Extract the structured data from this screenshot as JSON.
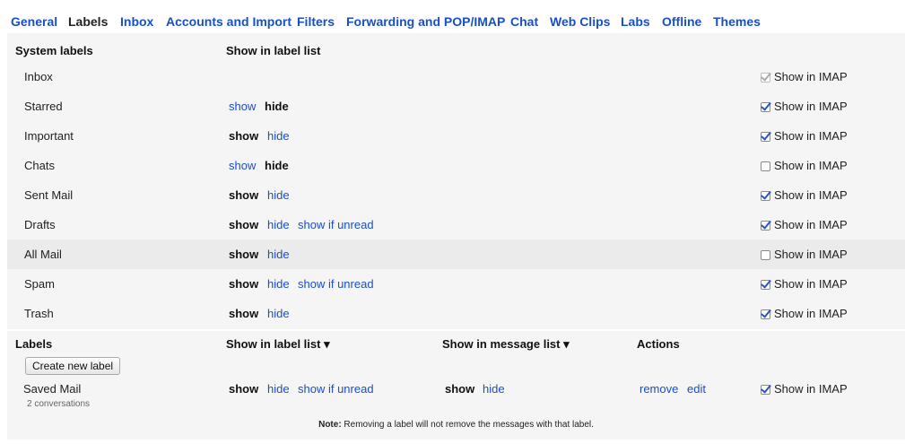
{
  "tabs": [
    "General",
    "Labels",
    "Inbox",
    "Accounts and Import",
    "Filters",
    "Forwarding and POP/IMAP",
    "Chat",
    "Web Clips",
    "Labs",
    "Offline",
    "Themes"
  ],
  "active_tab": "Labels",
  "system_section": {
    "header_labels": "System labels",
    "header_show": "Show in label list",
    "imap_label": "Show in IMAP",
    "rows": [
      {
        "name": "Inbox",
        "show": "",
        "hide": "",
        "unread": "",
        "imap_checked": true,
        "imap_disabled": true
      },
      {
        "name": "Starred",
        "show": "show",
        "hide": "hide",
        "selected": "hide",
        "unread": "",
        "imap_checked": true
      },
      {
        "name": "Important",
        "show": "show",
        "hide": "hide",
        "selected": "show",
        "unread": "",
        "imap_checked": true
      },
      {
        "name": "Chats",
        "show": "show",
        "hide": "hide",
        "selected": "hide",
        "unread": "",
        "imap_checked": false
      },
      {
        "name": "Sent Mail",
        "show": "show",
        "hide": "hide",
        "selected": "show",
        "unread": "",
        "imap_checked": true
      },
      {
        "name": "Drafts",
        "show": "show",
        "hide": "hide",
        "selected": "show",
        "unread": "show if unread",
        "imap_checked": true
      },
      {
        "name": "All Mail",
        "show": "show",
        "hide": "hide",
        "selected": "show",
        "unread": "",
        "imap_checked": false,
        "highlight": true
      },
      {
        "name": "Spam",
        "show": "show",
        "hide": "hide",
        "selected": "show",
        "unread": "show if unread",
        "imap_checked": true
      },
      {
        "name": "Trash",
        "show": "show",
        "hide": "hide",
        "selected": "show",
        "unread": "",
        "imap_checked": true
      }
    ]
  },
  "labels_section": {
    "header_labels": "Labels",
    "header_show_list": "Show in label list ▾",
    "header_show_message": "Show in message list ▾",
    "header_actions": "Actions",
    "create_button": "Create new label",
    "label": {
      "name": "Saved Mail",
      "count": "2 conversations",
      "list_show": "show",
      "list_hide": "hide",
      "list_unread": "show if unread",
      "msg_show": "show",
      "msg_hide": "hide",
      "remove": "remove",
      "edit": "edit",
      "imap": "Show in IMAP",
      "imap_checked": true
    },
    "note_bold": "Note:",
    "note_text": " Removing a label will not remove the messages with that label."
  }
}
